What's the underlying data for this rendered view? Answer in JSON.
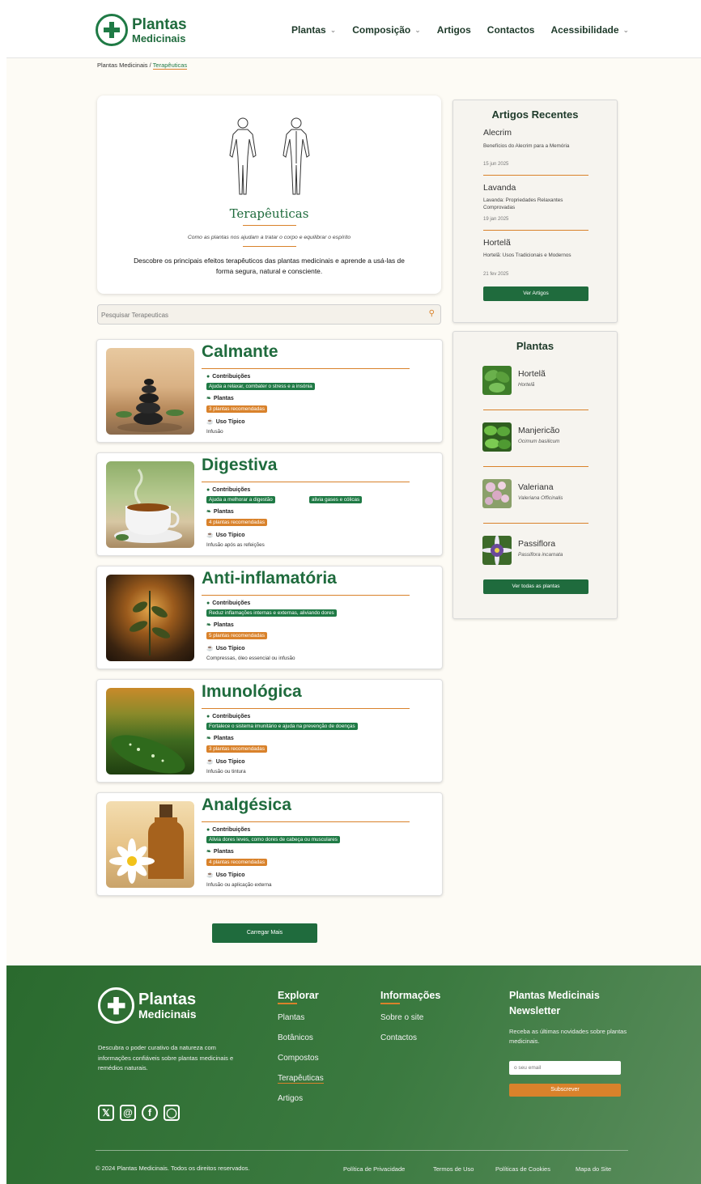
{
  "brand": {
    "line1": "Plantas",
    "line2": "Medicinais",
    "color": "#1f6b3d",
    "accent": "#d9822b"
  },
  "nav": [
    {
      "label": "Plantas",
      "has_dropdown": true
    },
    {
      "label": "Composição",
      "has_dropdown": true
    },
    {
      "label": "Artigos",
      "has_dropdown": false
    },
    {
      "label": "Contactos",
      "has_dropdown": false
    },
    {
      "label": "Acessibilidade",
      "has_dropdown": true
    }
  ],
  "breadcrumb": {
    "root": "Plantas Medicinais",
    "separator": " / ",
    "current": "Terapêuticas"
  },
  "hero": {
    "title": "Terapêuticas",
    "subtitle": "Como as plantas nos ajudam a tratar o corpo e equilibrar o espírito",
    "description": "Descobre os principais efeitos terapêuticos das plantas medicinais e aprende a usá-las de forma segura, natural e consciente."
  },
  "search": {
    "placeholder": "Pesquisar Terapeuticas"
  },
  "labels": {
    "contributions": "Contribuições",
    "plants": "Plantas",
    "usage": "Uso Típico"
  },
  "therapies": [
    {
      "name": "Calmante",
      "contributions": [
        "Ajuda a relaxar, combater o stress e a insónia"
      ],
      "plants": "3 plantas recomendadas",
      "usage": "Infusão"
    },
    {
      "name": "Digestiva",
      "contributions": [
        "Ajuda a melhorar a digestão",
        "alivia gases e cólicas"
      ],
      "plants": "4 plantas recomendadas",
      "usage": "Infusão após as refeições"
    },
    {
      "name": "Anti-inflamatória",
      "contributions": [
        "Reduz inflamações internas e externas, aliviando dores"
      ],
      "plants": "5 plantas recomendadas",
      "usage": "Compressas, óleo essencial ou infusão"
    },
    {
      "name": "Imunológica",
      "contributions": [
        "Fortalece o sistema imunitário e ajuda na prevenção de doenças"
      ],
      "plants": "3 plantas recomendadas",
      "usage": "Infusão ou tintura"
    },
    {
      "name": "Analgésica",
      "contributions": [
        "Alivia dores leves, como dores de cabeça ou musculares"
      ],
      "plants": "4 plantas recomendadas",
      "usage": "Infusão ou aplicação externa"
    }
  ],
  "load_more": "Carregar Mais",
  "recent_articles": {
    "title": "Artigos Recentes",
    "items": [
      {
        "title": "Alecrim",
        "desc": "Benefícios do Alecrim para a Memória",
        "date": "15 jun 2025"
      },
      {
        "title": "Lavanda",
        "desc": "Lavanda: Propriedades Relaxantes Comprovadas",
        "date": "19 jan 2025"
      },
      {
        "title": "Hortelã",
        "desc": "Hortelã: Usos Tradicionais e Modernos",
        "date": "21 fev 2025"
      }
    ],
    "button": "Ver Artigos"
  },
  "plants_box": {
    "title": "Plantas",
    "items": [
      {
        "name": "Hortelã",
        "sci": "Hortelã"
      },
      {
        "name": "Manjericão",
        "sci": "Ocimum basilicum"
      },
      {
        "name": "Valeriana",
        "sci": "Valeriana Officinalis"
      },
      {
        "name": "Passiflora",
        "sci": "Passiflora incarnata"
      }
    ],
    "button": "Ver todas as plantas"
  },
  "footer": {
    "about": "Descubra o poder curativo da natureza com informações confiáveis sobre plantas medicinais e remédios naturais.",
    "socials": [
      "x-icon",
      "threads-icon",
      "facebook-icon",
      "instagram-icon"
    ],
    "explore": {
      "title": "Explorar",
      "links": [
        "Plantas",
        "Botânicos",
        "Compostos",
        "Terapêuticas",
        "Artigos"
      ],
      "current": "Terapêuticas"
    },
    "info": {
      "title": "Informações",
      "links": [
        "Sobre o site",
        "Contactos"
      ]
    },
    "newsletter": {
      "title": "Plantas Medicinais Newsletter",
      "desc": "Receba as últimas novidades sobre plantas medicinais.",
      "placeholder": "o seu email",
      "button": "Subscrever"
    },
    "copyright": "© 2024 Plantas Medicinais. Todos os direitos reservados.",
    "legal": [
      "Política de Privacidade",
      "Termos de Uso",
      "Políticas de Cookies",
      "Mapa do Site"
    ]
  }
}
